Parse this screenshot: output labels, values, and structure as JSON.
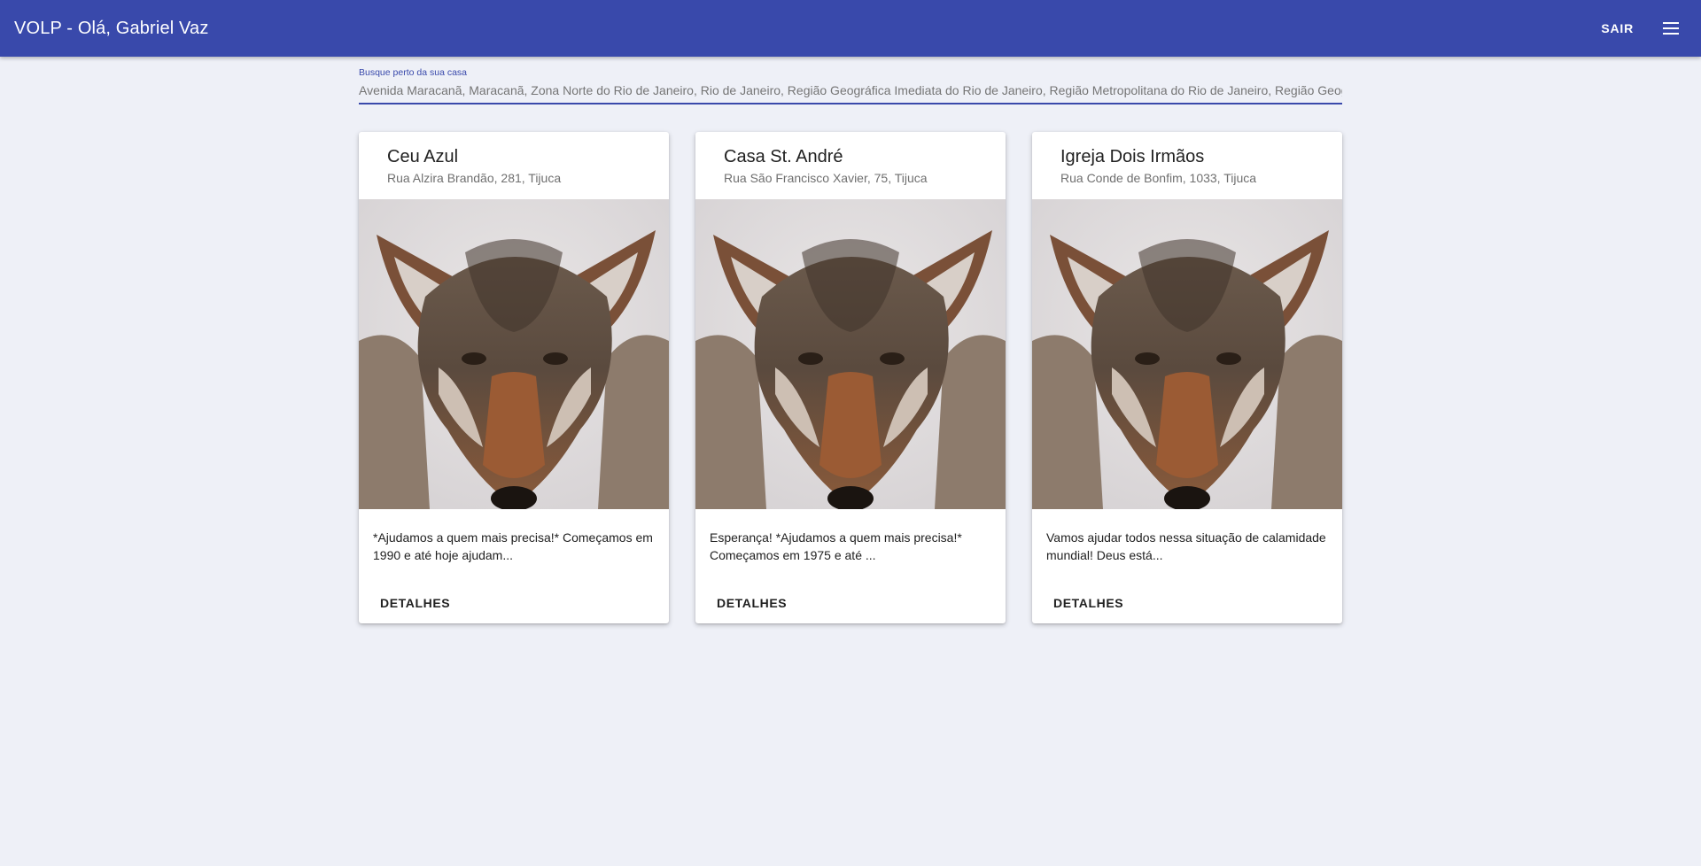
{
  "appbar": {
    "title": "VOLP - Olá, Gabriel Vaz",
    "logout_label": "SAIR",
    "menu_icon": "hamburger-menu-icon",
    "color": "#3949ab"
  },
  "search": {
    "label": "Busque perto da sua casa",
    "value": "Avenida Maracanã, Maracanã, Zona Norte do Rio de Janeiro, Rio de Janeiro, Região Geográfica Imediata do Rio de Janeiro, Região Metropolitana do Rio de Janeiro, Região Geográf"
  },
  "cards": [
    {
      "name": "Ceu Azul",
      "address": "Rua Alzira Brandão, 281, Tijuca",
      "description": "*Ajudamos a quem mais precisa!* Começamos em 1990 e até hoje ajudam...",
      "button_label": "DETALHES"
    },
    {
      "name": "Casa St. André",
      "address": "Rua São Francisco Xavier, 75, Tijuca",
      "description": "Esperança! *Ajudamos a quem mais precisa!* Começamos em 1975 e até ...",
      "button_label": "DETALHES"
    },
    {
      "name": "Igreja Dois Irmãos",
      "address": "Rua Conde de Bonfim, 1033, Tijuca",
      "description": "Vamos ajudar todos nessa situação de calamidade mundial! Deus está...",
      "button_label": "DETALHES"
    }
  ]
}
